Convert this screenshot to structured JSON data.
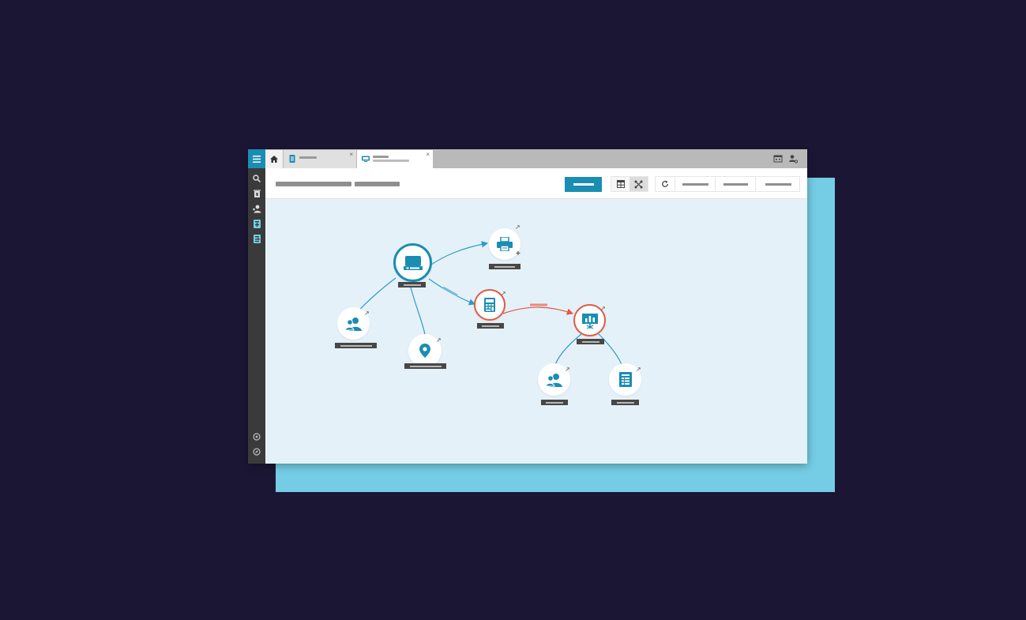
{
  "app": {
    "close_glyph": "×",
    "rail": {
      "icons": [
        "menu-icon",
        "search-icon",
        "trash-icon",
        "user-headset-icon",
        "phone-add-icon",
        "phone-transfer-icon",
        "help-icon",
        "compass-icon"
      ]
    },
    "tabs": [
      {
        "kind": "home",
        "icon": "home-icon"
      },
      {
        "kind": "document",
        "icon": "document-icon"
      },
      {
        "kind": "device",
        "icon": "device-icon",
        "active": true
      }
    ],
    "strip_icons": [
      "calendar-icon",
      "user-settings-icon"
    ],
    "toolbar": {
      "view_buttons": [
        "table-view-icon",
        "graph-view-icon"
      ],
      "actions": [
        "refresh-icon"
      ]
    },
    "graph": {
      "nodes": [
        {
          "id": "device",
          "icon": "laptop-icon",
          "style": "main"
        },
        {
          "id": "printer",
          "icon": "printer-icon",
          "style": "normal",
          "plus": "+"
        },
        {
          "id": "people-left",
          "icon": "people-icon",
          "style": "normal"
        },
        {
          "id": "location",
          "icon": "location-icon",
          "style": "normal"
        },
        {
          "id": "calculator",
          "icon": "calculator-icon",
          "style": "alert"
        },
        {
          "id": "presentation",
          "icon": "presentation-icon",
          "style": "alert"
        },
        {
          "id": "people-bottom",
          "icon": "people-icon",
          "style": "normal"
        },
        {
          "id": "report",
          "icon": "report-icon",
          "style": "normal"
        }
      ],
      "ext_glyph": "↗"
    },
    "colors": {
      "accent": "#1a8db3",
      "alert": "#e05a47",
      "background": "#1c1635",
      "backdrop": "#74cde4",
      "canvas": "#e5f1f8"
    }
  }
}
